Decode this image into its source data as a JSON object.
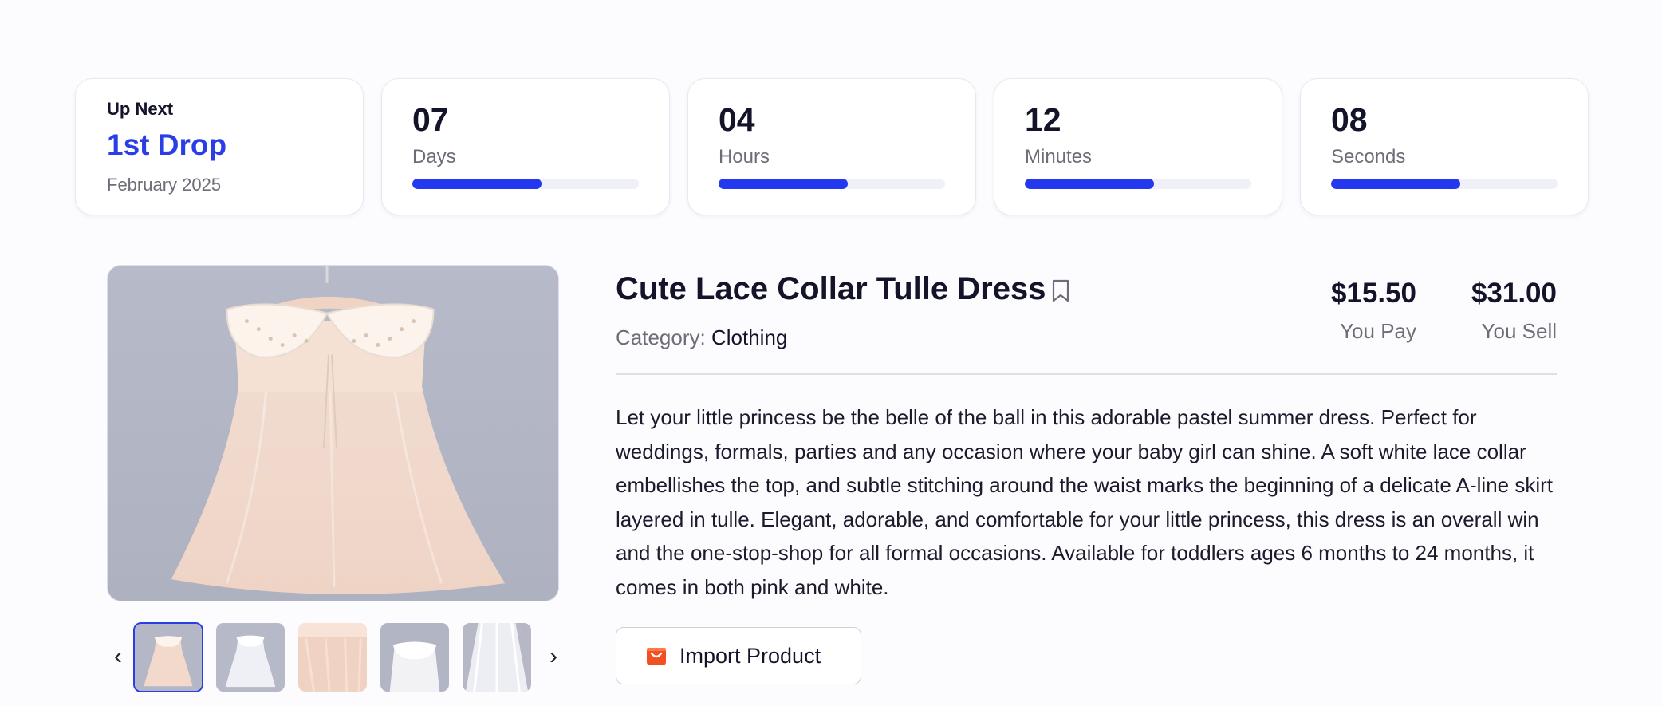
{
  "up_next": {
    "label": "Up Next",
    "drop_name": "1st Drop",
    "date": "February 2025"
  },
  "countdown": [
    {
      "value": "07",
      "unit": "Days",
      "progress": 0.57
    },
    {
      "value": "04",
      "unit": "Hours",
      "progress": 0.57
    },
    {
      "value": "12",
      "unit": "Minutes",
      "progress": 0.57
    },
    {
      "value": "08",
      "unit": "Seconds",
      "progress": 0.57
    }
  ],
  "product": {
    "title": "Cute Lace Collar Tulle Dress",
    "category_label": "Category:",
    "category_value": "Clothing",
    "price_pay": "$15.50",
    "price_pay_caption": "You Pay",
    "price_sell": "$31.00",
    "price_sell_caption": "You Sell",
    "description": "Let your little princess be the belle of the ball in this adorable pastel summer dress. Perfect for weddings, formals, parties and any occasion where your baby girl can shine. A soft white lace collar embellishes the top, and subtle stitching around the waist marks the beginning of a delicate A-line skirt layered in tulle. Elegant, adorable, and comfortable for your little princess, this dress is an overall win and the one-stop-shop for all formal occasions. Available for toddlers ages 6 months to 24 months, it comes in both pink and white.",
    "import_label": "Import Product"
  },
  "gallery": {
    "prev_icon": "‹",
    "next_icon": "›",
    "thumbnails": [
      "pink-dress-front",
      "white-dress-front",
      "pink-tulle-closeup",
      "white-dress-collar",
      "white-tulle-skirt"
    ],
    "active_index": 0
  },
  "colors": {
    "accent": "#2a3ee8",
    "progress_fill": "#2438f0",
    "import_icon": "#f25022"
  },
  "icons": {
    "bookmark": "bookmark-icon",
    "import": "shopping-bag-icon",
    "prev": "chevron-left-icon",
    "next": "chevron-right-icon"
  }
}
